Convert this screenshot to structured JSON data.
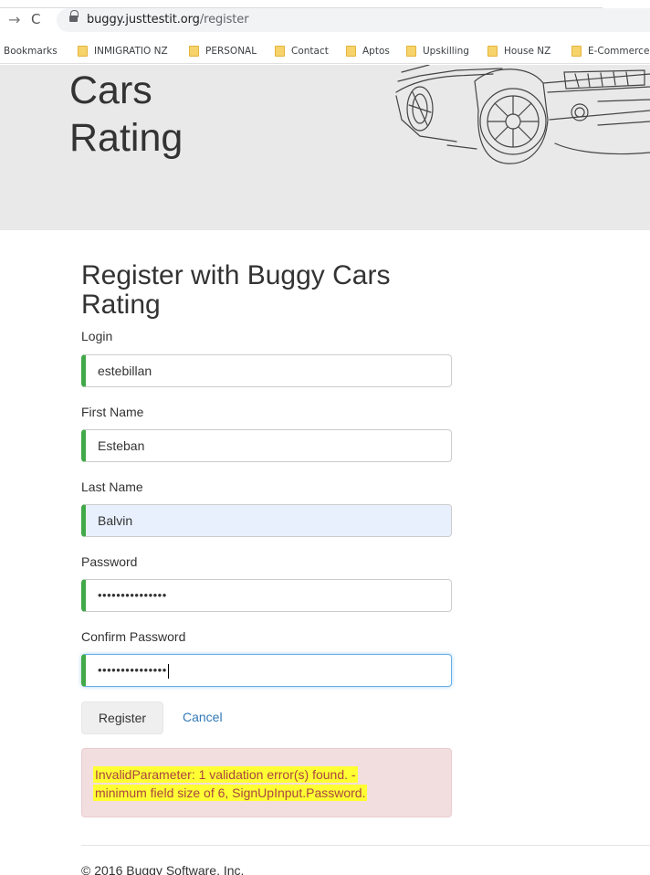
{
  "browser": {
    "url_domain": "buggy.justtestit.org",
    "url_path": "/register",
    "back_glyph": "→",
    "reload_glyph": "C",
    "bookmarks_label": "Bookmarks",
    "bookmarks": [
      "INMIGRATIO NZ",
      "PERSONAL",
      "Contact",
      "Aptos",
      "Upskilling",
      "House NZ",
      "E-Commerce"
    ]
  },
  "hero": {
    "title_line1": "Cars",
    "title_line2": "Rating"
  },
  "form": {
    "title": "Register with Buggy Cars Rating",
    "login_label": "Login",
    "login_value": "estebillan",
    "first_name_label": "First Name",
    "first_name_value": "Esteban",
    "last_name_label": "Last Name",
    "last_name_value": "Balvin",
    "password_label": "Password",
    "password_value": "•••••••••••••••",
    "confirm_label": "Confirm Password",
    "confirm_value": "•••••••••••••••",
    "register_label": "Register",
    "cancel_label": "Cancel"
  },
  "alert": {
    "line1": "InvalidParameter: 1 validation error(s) found. -",
    "line2": "minimum field size of 6, SignUpInput.Password."
  },
  "footer": {
    "copyright": "© 2016 Buggy Software, Inc."
  },
  "colors": {
    "valid_border": "#42a948",
    "alert_bg": "#f2dede",
    "alert_text": "#a94442",
    "highlight": "#ffff33",
    "link": "#337ab7"
  }
}
